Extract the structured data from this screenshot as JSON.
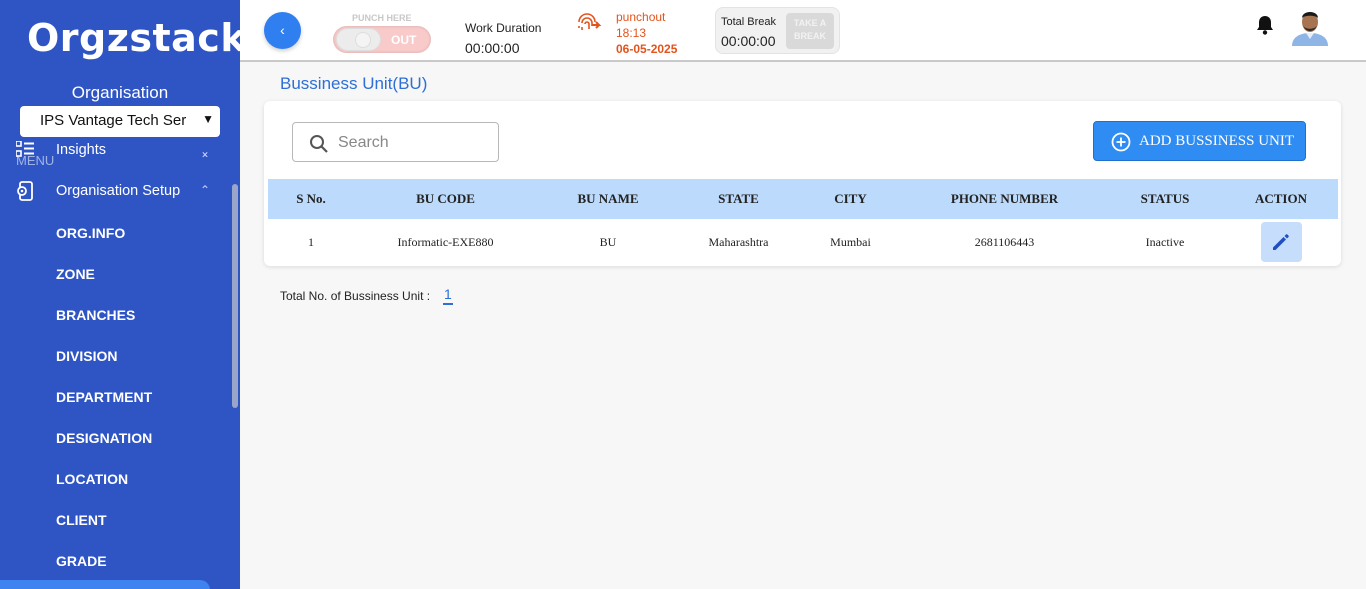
{
  "sidebar": {
    "logo": "Orgzstack",
    "org_label": "Organisation",
    "org_selected": "IPS Vantage Tech Ser",
    "menu_label": "MENU",
    "items": [
      {
        "label": "Insights",
        "icon": "list-grid-icon"
      },
      {
        "label": "Organisation Setup",
        "icon": "org-settings-icon"
      },
      {
        "label": "ORG.INFO"
      },
      {
        "label": "ZONE"
      },
      {
        "label": "BRANCHES"
      },
      {
        "label": "DIVISION"
      },
      {
        "label": "DEPARTMENT"
      },
      {
        "label": "DESIGNATION"
      },
      {
        "label": "LOCATION"
      },
      {
        "label": "CLIENT"
      },
      {
        "label": "GRADE"
      }
    ]
  },
  "header": {
    "back_symbol": "‹",
    "punch_label": "PUNCH HERE",
    "punch_state": "OUT",
    "work_duration_label": "Work Duration",
    "work_duration_value": "00:00:00",
    "punch_status": "punchout",
    "punch_time": "18:13",
    "punch_date": "06-05-2025",
    "total_break_label": "Total Break",
    "total_break_value": "00:00:00",
    "take_break_line1": "TAKE A",
    "take_break_line2": "BREAK"
  },
  "main": {
    "page_title": "Bussiness Unit(BU)",
    "search_placeholder": "Search",
    "add_button_label": "ADD BUSSINESS UNIT",
    "table": {
      "headers": [
        "S No.",
        "BU CODE",
        "BU NAME",
        "STATE",
        "CITY",
        "PHONE NUMBER",
        "STATUS",
        "ACTION"
      ],
      "rows": [
        [
          "1",
          "Informatic-EXE880",
          "BU",
          "Maharashtra",
          "Mumbai",
          "2681106443",
          "Inactive"
        ]
      ]
    },
    "total_label": "Total No. of Bussiness Unit :",
    "total_value": "1"
  },
  "colors": {
    "sidebar_bg": "#2f55c4",
    "accent": "#2f8cf3",
    "table_header": "#bcdafb",
    "punchout": "#e2541c"
  }
}
